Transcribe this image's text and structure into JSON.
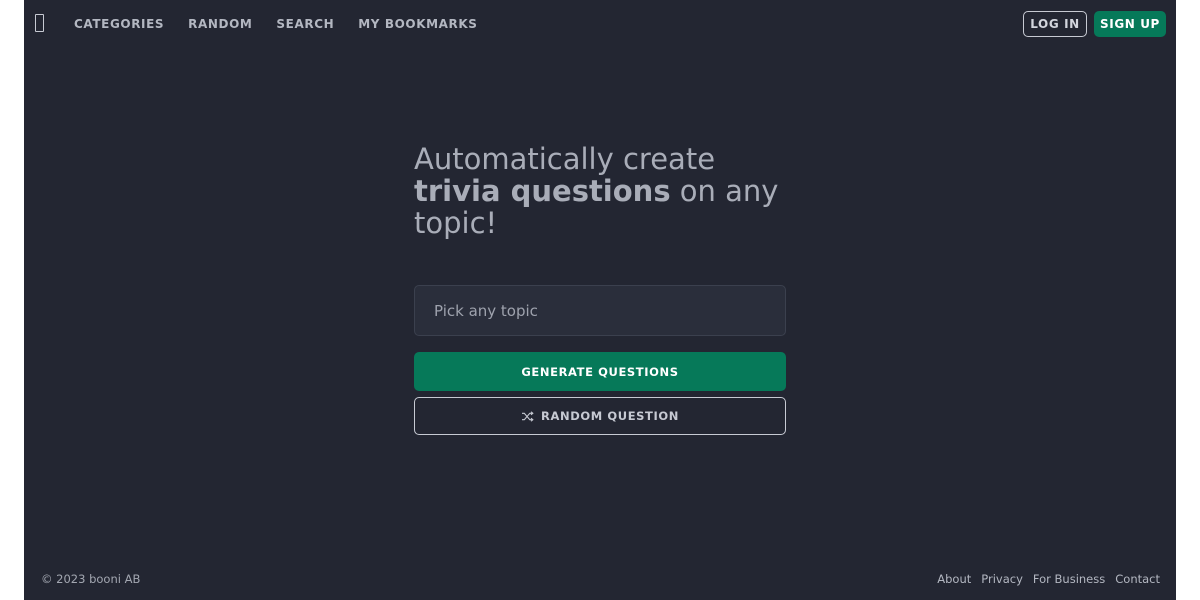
{
  "nav": {
    "logo_icon": "logo-icon",
    "links": [
      {
        "label": "CATEGORIES"
      },
      {
        "label": "RANDOM"
      },
      {
        "label": "SEARCH"
      },
      {
        "label": "MY BOOKMARKS"
      }
    ],
    "login_label": "LOG IN",
    "signup_label": "SIGN UP"
  },
  "hero": {
    "line_start": "Automatically create ",
    "bold_text": "trivia questions",
    "line_end": " on any topic!"
  },
  "topic_input": {
    "placeholder": "Pick any topic",
    "value": ""
  },
  "buttons": {
    "generate_label": "GENERATE QUESTIONS",
    "random_label": "RANDOM QUESTION",
    "random_icon": "shuffle-icon"
  },
  "footer": {
    "copyright": "© 2023 booni AB",
    "links": [
      {
        "label": "About"
      },
      {
        "label": "Privacy"
      },
      {
        "label": "For Business"
      },
      {
        "label": "Contact"
      }
    ]
  },
  "colors": {
    "background": "#232632",
    "accent": "#067959",
    "text": "#c7cad3"
  }
}
